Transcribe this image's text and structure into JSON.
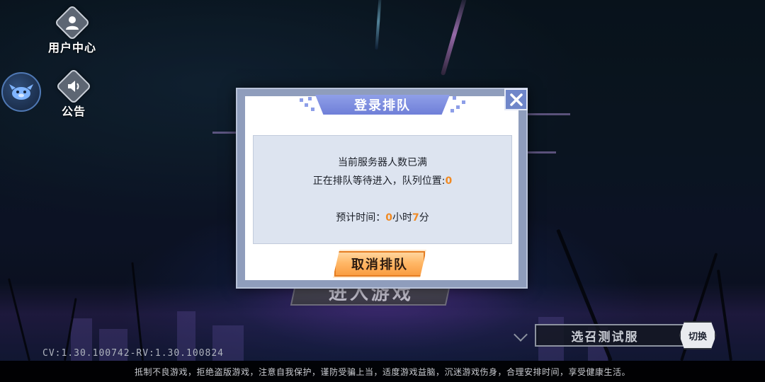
{
  "side_menu": {
    "user_center_label": "用户中心",
    "notice_label": "公告"
  },
  "dialog": {
    "title": "登录排队",
    "message_line1": "当前服务器人数已满",
    "message_line2_prefix": "正在排队等待进入，队列位置:",
    "queue_position": "0",
    "estimate_prefix": "预计时间：",
    "estimate_hours": "0",
    "estimate_hours_unit": "小时",
    "estimate_minutes": "7",
    "estimate_minutes_unit": "分",
    "cancel_label": "取消排队",
    "highlight_color": "#f08a24"
  },
  "enter_game_label": "进入游戏",
  "server": {
    "name": "选召测试服",
    "switch_label": "切换"
  },
  "version_text": "CV:1.30.100742-RV:1.30.100824",
  "footer_text": "抵制不良游戏，拒绝盗版游戏，注意自我保护，谨防受骗上当，适度游戏益脑，沉迷游戏伤身，合理安排时间，享受健康生活。"
}
